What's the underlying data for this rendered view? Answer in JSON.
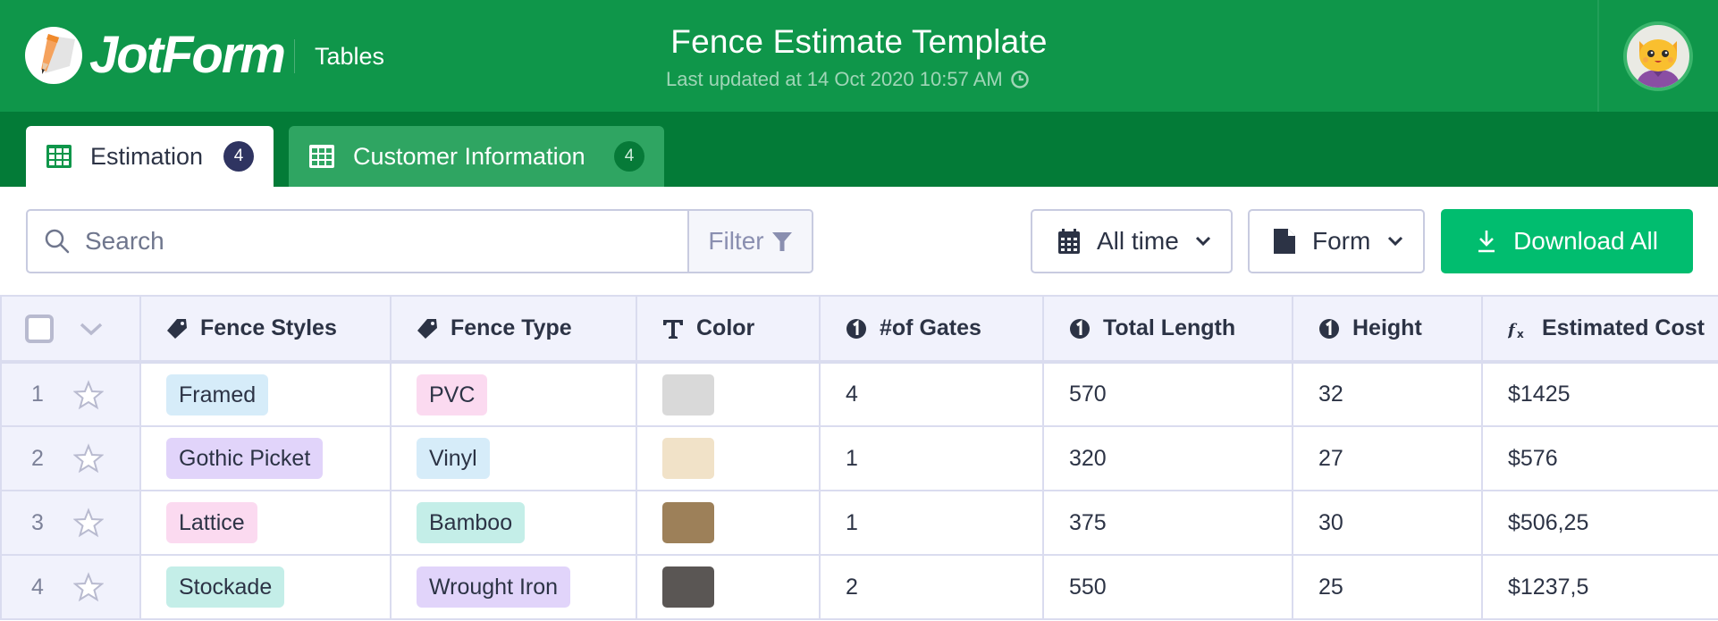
{
  "header": {
    "brand": "JotForm",
    "app_name": "Tables",
    "title": "Fence Estimate Template",
    "last_updated": "Last updated at 14 Oct 2020 10:57 AM",
    "avatar_alt": "User avatar"
  },
  "tabs": [
    {
      "label": "Estimation",
      "count": "4",
      "active": true,
      "icon": "table-grid-icon"
    },
    {
      "label": "Customer Information",
      "count": "4",
      "active": false,
      "icon": "table-grid-icon"
    }
  ],
  "toolbar": {
    "search_placeholder": "Search",
    "search_value": "",
    "filter_label": "Filter",
    "time_filter": {
      "label": "All time",
      "icon": "calendar-icon"
    },
    "form_filter": {
      "label": "Form",
      "icon": "file-icon"
    },
    "download_label": "Download All",
    "download_color": "#01bd6f"
  },
  "table": {
    "columns": [
      {
        "label": "Fence Styles",
        "icon": "tag-icon"
      },
      {
        "label": "Fence Type",
        "icon": "tag-icon"
      },
      {
        "label": "Color",
        "icon": "text-type-icon"
      },
      {
        "label": "#of Gates",
        "icon": "number-icon"
      },
      {
        "label": "Total Length",
        "icon": "number-icon"
      },
      {
        "label": "Height",
        "icon": "number-icon"
      },
      {
        "label": "Estimated Cost",
        "icon": "formula-icon"
      }
    ],
    "rows": [
      {
        "num": "1",
        "style": "Framed",
        "style_color": "#d6ecf9",
        "type": "PVC",
        "type_color": "#fbdaf0",
        "swatch": "#d9d9d9",
        "gates": "4",
        "length": "570",
        "height": "32",
        "cost": "$1425"
      },
      {
        "num": "2",
        "style": "Gothic Picket",
        "style_color": "#e1d4fa",
        "type": "Vinyl",
        "type_color": "#d6ecf9",
        "swatch": "#f1e2c8",
        "gates": "1",
        "length": "320",
        "height": "27",
        "cost": "$576"
      },
      {
        "num": "3",
        "style": "Lattice",
        "style_color": "#fbdaf0",
        "type": "Bamboo",
        "type_color": "#c4eee8",
        "swatch": "#9d8059",
        "gates": "1",
        "length": "375",
        "height": "30",
        "cost": "$506,25"
      },
      {
        "num": "4",
        "style": "Stockade",
        "style_color": "#c4eee8",
        "type": "Wrought Iron",
        "type_color": "#e1d4fa",
        "swatch": "#5a5654",
        "gates": "2",
        "length": "550",
        "height": "25",
        "cost": "$1237,5"
      }
    ]
  },
  "colors": {
    "header_green": "#0f964a",
    "tabband_green": "#037b37",
    "inactive_tab_green": "#2fa562",
    "active_badge": "#2f3461"
  }
}
